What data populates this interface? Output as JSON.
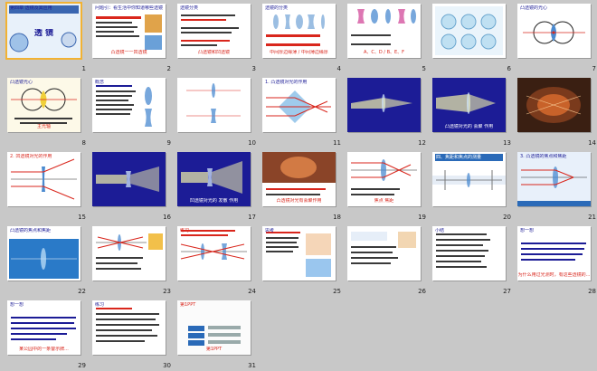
{
  "slides": [
    {
      "num": "1",
      "bg": "#ffffff",
      "title": "第四章 透镜及其应用",
      "caption": "透 镜"
    },
    {
      "num": "2",
      "bg": "#ffffff",
      "title": "问题引：看生活中你知道哪些透镜的应用？",
      "caption": "凸透镜一一凹透镜"
    },
    {
      "num": "3",
      "bg": "#ffffff",
      "title": "透镜分类",
      "caption": "凸透镜和凹透镜"
    },
    {
      "num": "4",
      "bg": "#ffffff",
      "title": "透镜的分类",
      "caption": "中间厚边缘薄 / 中间薄边缘厚"
    },
    {
      "num": "5",
      "bg": "#ffffff",
      "title": "",
      "caption": "A、C、D / B、E、F"
    },
    {
      "num": "6",
      "bg": "#ffffff",
      "title": "",
      "caption": ""
    },
    {
      "num": "7",
      "bg": "#ffffff",
      "title": "凸透镜的光心",
      "caption": ""
    },
    {
      "num": "8",
      "bg": "#ffffff",
      "title": "凸透镜光心",
      "caption": "主光轴"
    },
    {
      "num": "9",
      "bg": "#ffffff",
      "title": "概念",
      "caption": ""
    },
    {
      "num": "10",
      "bg": "#ffffff",
      "title": "",
      "caption": ""
    },
    {
      "num": "11",
      "bg": "#ffffff",
      "title": "1. 凸透镜对光的作用",
      "caption": ""
    },
    {
      "num": "12",
      "bg": "#1c1c96",
      "title": "",
      "caption": ""
    },
    {
      "num": "13",
      "bg": "#1c1c96",
      "title": "",
      "caption": "凸透镜对光的 会聚 作用"
    },
    {
      "num": "14",
      "bg": "#ffffff",
      "title": "",
      "caption": ""
    },
    {
      "num": "15",
      "bg": "#ffffff",
      "title": "2. 凹透镜对光的作用",
      "caption": ""
    },
    {
      "num": "16",
      "bg": "#1c1c96",
      "title": "",
      "caption": ""
    },
    {
      "num": "17",
      "bg": "#1c1c96",
      "title": "",
      "caption": "凹透镜对光的 发散 作用"
    },
    {
      "num": "18",
      "bg": "#ffffff",
      "title": "",
      "caption": "凸透镜对光有会聚作用"
    },
    {
      "num": "19",
      "bg": "#ffffff",
      "title": "",
      "caption": "焦点 焦距"
    },
    {
      "num": "20",
      "bg": "#ffffff",
      "title": "四、焦距和焦点的测量",
      "caption": ""
    },
    {
      "num": "21",
      "bg": "#ffffff",
      "title": "3. 凸透镜的焦点和焦距",
      "caption": ""
    },
    {
      "num": "22",
      "bg": "#ffffff",
      "title": "凸透镜的焦点和焦距",
      "caption": ""
    },
    {
      "num": "23",
      "bg": "#ffffff",
      "title": "",
      "caption": ""
    },
    {
      "num": "24",
      "bg": "#ffffff",
      "title": "练习",
      "caption": ""
    },
    {
      "num": "25",
      "bg": "#ffffff",
      "title": "思考",
      "caption": ""
    },
    {
      "num": "26",
      "bg": "#ffffff",
      "title": "",
      "caption": ""
    },
    {
      "num": "27",
      "bg": "#ffffff",
      "title": "小结",
      "caption": ""
    },
    {
      "num": "28",
      "bg": "#ffffff",
      "title": "想一想",
      "caption": "为什么用过光测时，有这些透镜的..."
    },
    {
      "num": "29",
      "bg": "#ffffff",
      "title": "想一想",
      "caption": "某公园中的一条警示牌..."
    },
    {
      "num": "30",
      "bg": "#ffffff",
      "title": "练习",
      "caption": ""
    },
    {
      "num": "31",
      "bg": "#ffffff",
      "title": "第1PPT",
      "caption": "第1PPT"
    }
  ],
  "colors": {
    "accent_red": "#d9261c",
    "dark_blue": "#1c1c96",
    "selection": "#f2b233",
    "lens_blue": "#4a8ad0"
  }
}
